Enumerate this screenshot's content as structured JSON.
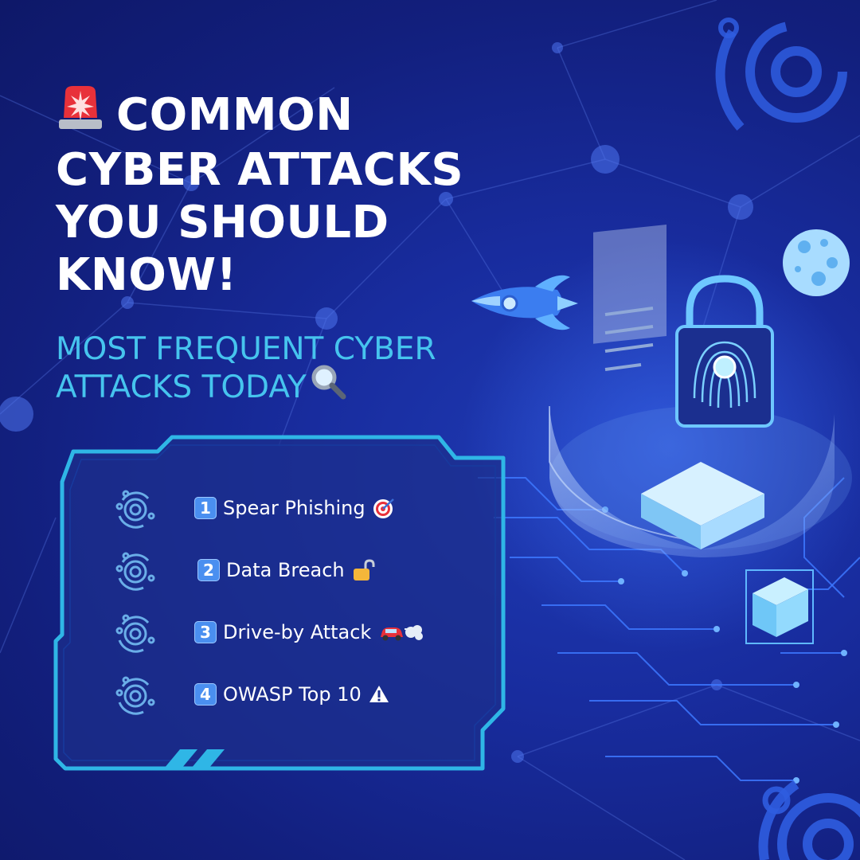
{
  "title_lines": [
    "COMMON",
    "CYBER ATTACKS",
    "YOU SHOULD",
    "KNOW!"
  ],
  "subtitle_lines": [
    "MOST FREQUENT CYBER",
    "ATTACKS TODAY"
  ],
  "icons": {
    "title": "siren-icon",
    "subtitle": "magnifying-glass-icon",
    "list_bullet": "cyber-ring-icon",
    "decor": [
      "rocket-icon",
      "moon-icon",
      "padlock-fingerprint-icon",
      "cube-icon",
      "document-icon"
    ]
  },
  "list": [
    {
      "number": "1",
      "label": "Spear Phishing",
      "emoji": "target-icon"
    },
    {
      "number": "2",
      "label": "Data Breach",
      "emoji": "unlocked-padlock-icon"
    },
    {
      "number": "3",
      "label": "Drive-by Attack",
      "emoji": "car-dash-icon"
    },
    {
      "number": "4",
      "label": "OWASP Top 10",
      "emoji": "warning-icon"
    }
  ],
  "colors": {
    "background": "#16278f",
    "title": "#ffffff",
    "subtitle": "#46c4ee",
    "panel_border": "#2fb6e6",
    "accent": "#4a8ff0"
  }
}
